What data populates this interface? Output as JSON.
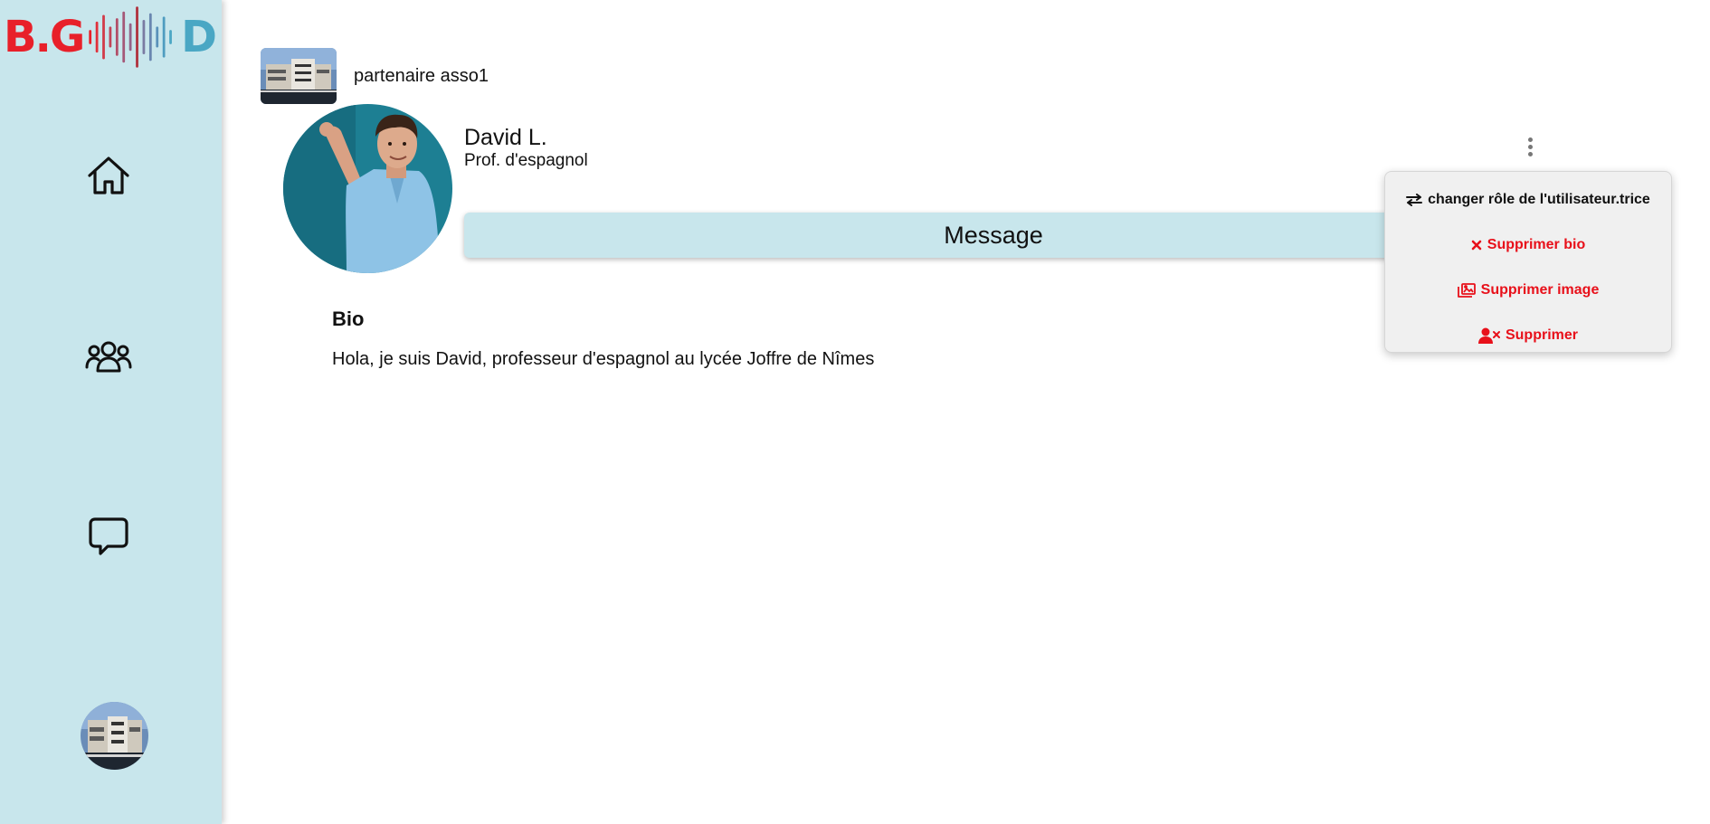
{
  "logo": {
    "left": "B.G",
    "right": "D",
    "colors": {
      "left": "#e8202a",
      "right": "#4aa7c4"
    }
  },
  "sidebar": {
    "background": "#c8e6ec",
    "nav": [
      {
        "icon": "home-icon"
      },
      {
        "icon": "users-icon"
      },
      {
        "icon": "chat-bubble-icon"
      }
    ]
  },
  "partner": {
    "name": "partenaire asso1"
  },
  "profile": {
    "name": "David L.",
    "role": "Prof. d'espagnol",
    "message_label": "Message",
    "bio_title": "Bio",
    "bio_text": "Hola, je suis David, professeur d'espagnol au lycée Joffre de Nîmes"
  },
  "menu": {
    "items": [
      {
        "label": "changer rôle de l'utilisateur.trice",
        "icon": "swap-arrows-icon",
        "color": "#111111"
      },
      {
        "label": "Supprimer bio",
        "icon": "x-icon",
        "color": "#e8101a"
      },
      {
        "label": "Supprimer image",
        "icon": "images-icon",
        "color": "#e8101a"
      },
      {
        "label": "Supprimer",
        "icon": "user-remove-icon",
        "color": "#e8101a"
      }
    ]
  }
}
